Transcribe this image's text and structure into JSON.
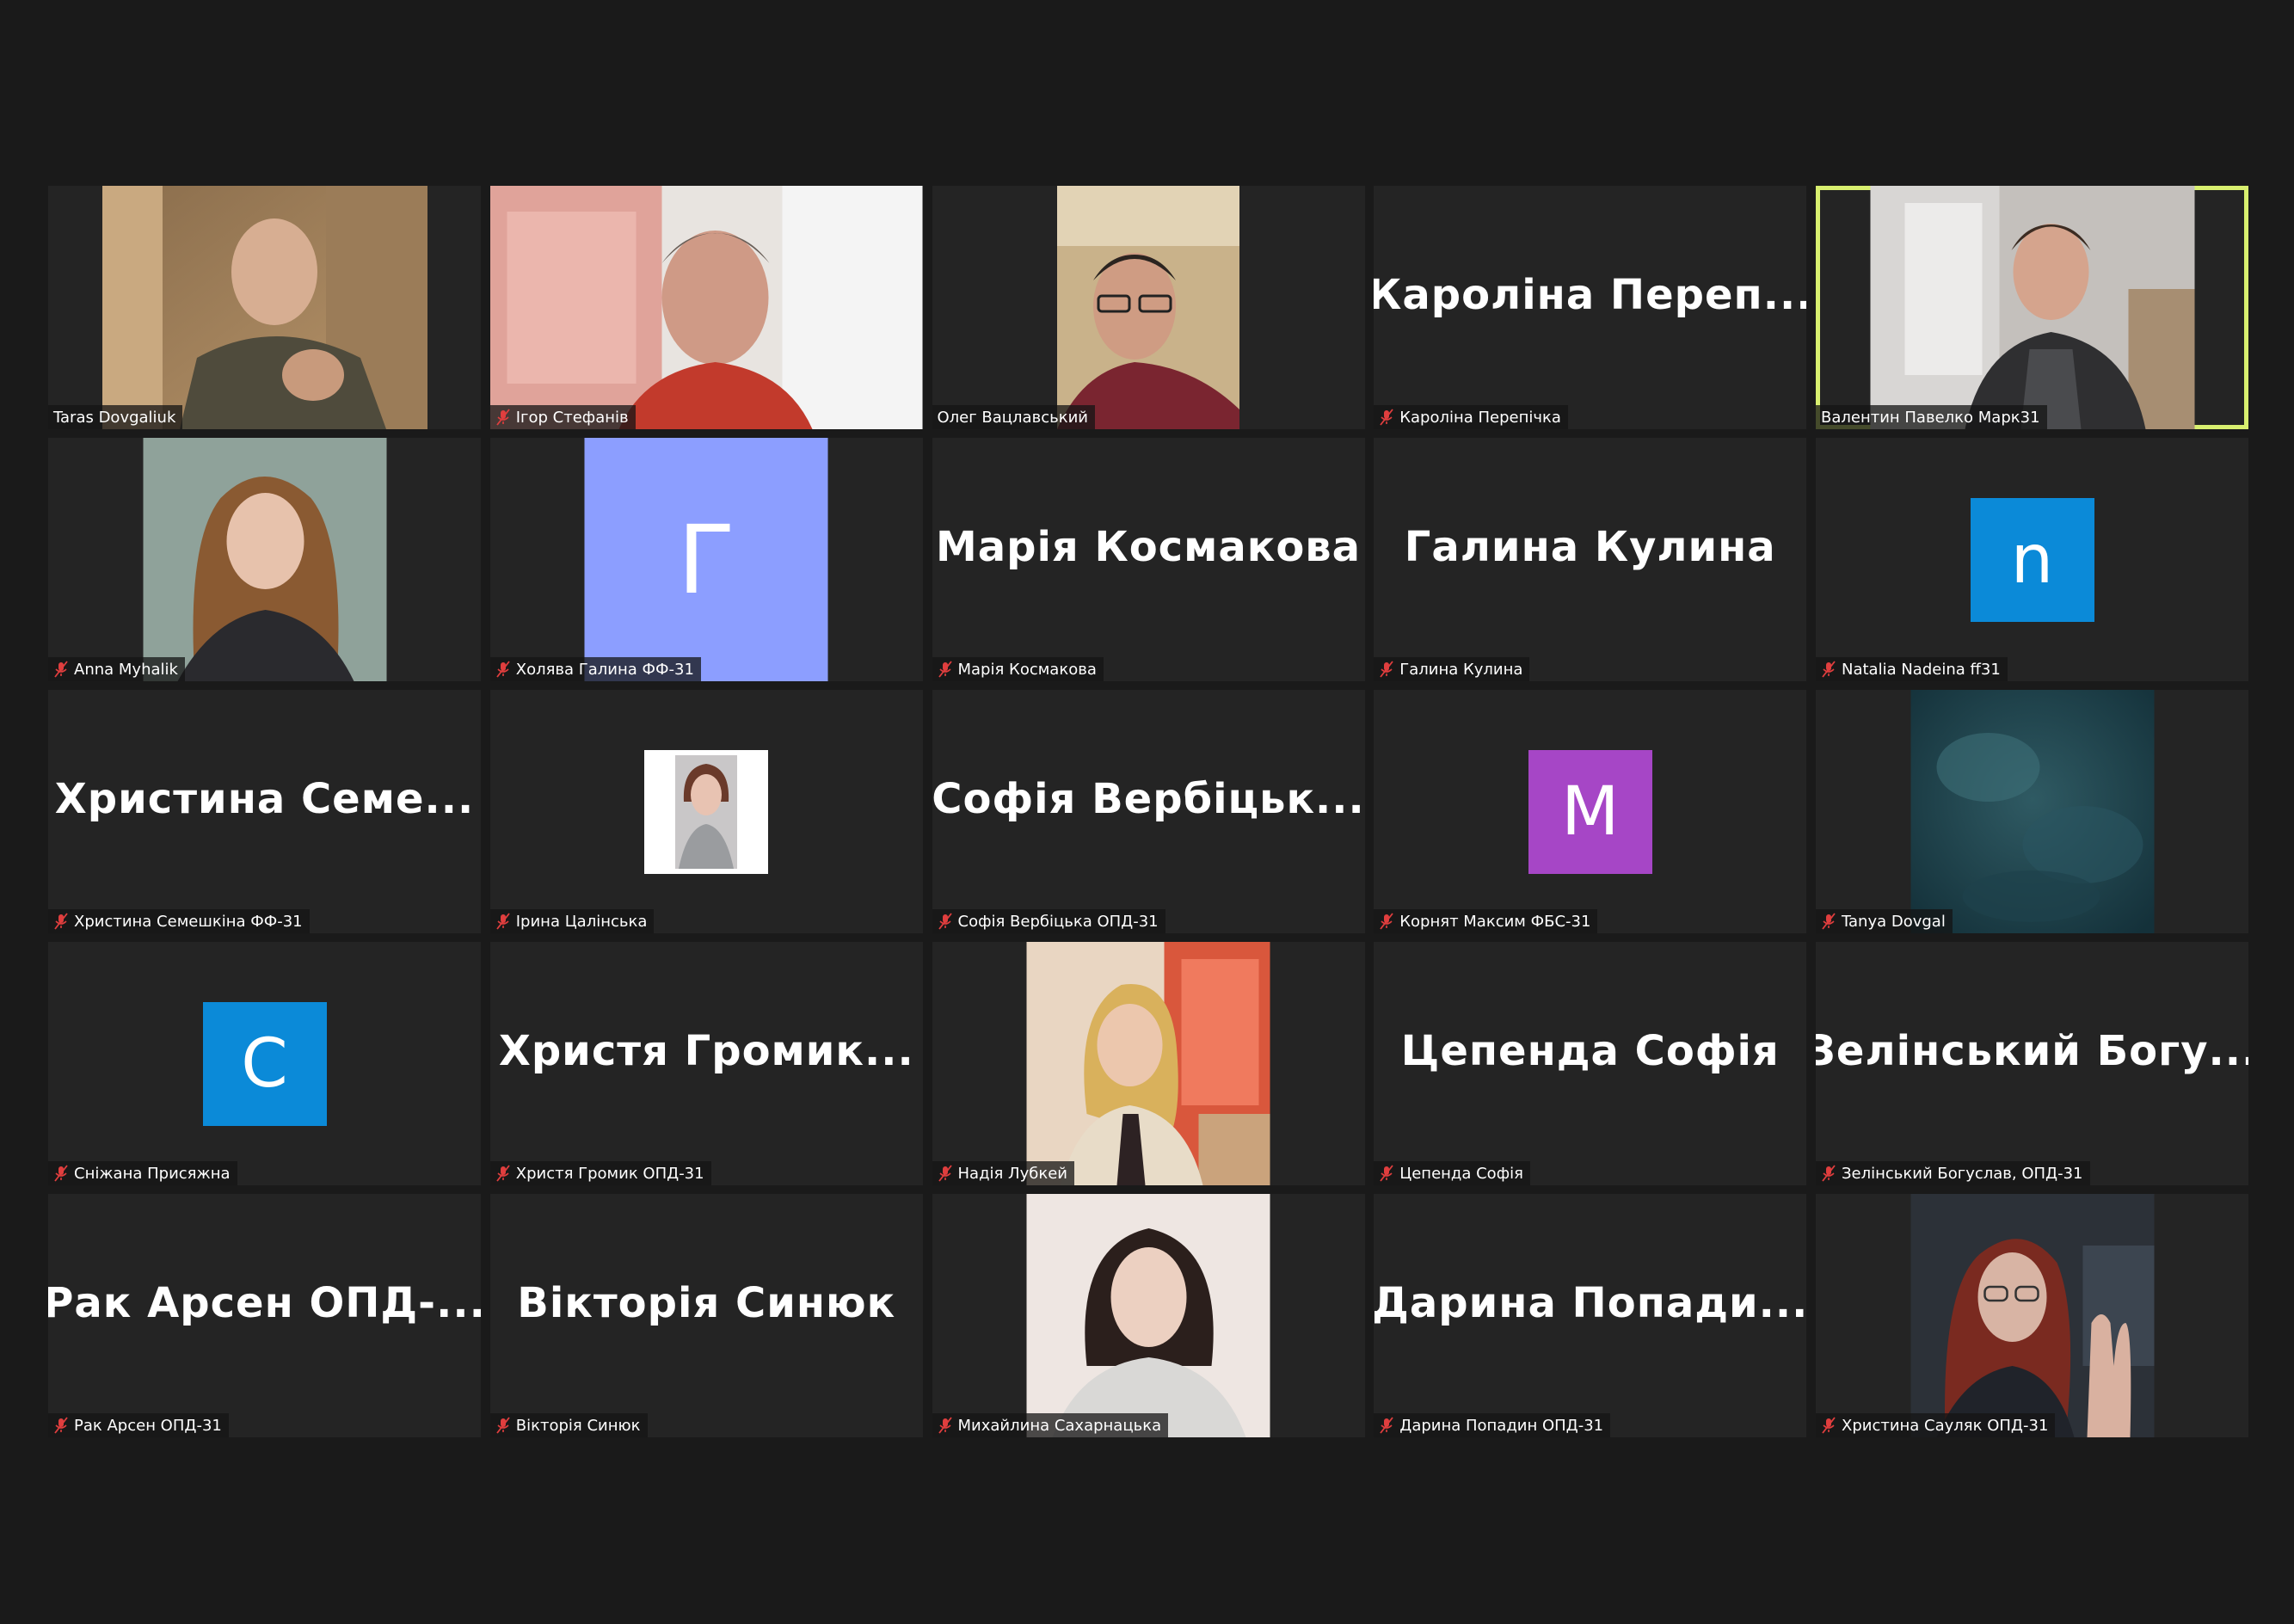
{
  "accent_colors": {
    "active_speaker_border": "#d8ef6f",
    "tile_bg": "#242424",
    "muted_icon": "#e03e3e"
  },
  "participants": [
    {
      "label": "Taras Dovgaliuk",
      "muted": false,
      "display": "video"
    },
    {
      "label": "Ігор Стефанів",
      "muted": true,
      "display": "video"
    },
    {
      "label": "Олег Вацлавський",
      "muted": false,
      "display": "video"
    },
    {
      "label": "Кароліна Перепічка",
      "muted": true,
      "display": "name",
      "big_name": "Кароліна  Переп..."
    },
    {
      "label": "Валентин Павелко Марк31",
      "muted": false,
      "display": "video",
      "active": true
    },
    {
      "label": "Anna Myhalik",
      "muted": true,
      "display": "photo"
    },
    {
      "label": "Холява Галина ФФ-31",
      "muted": true,
      "display": "letter",
      "initial": "Г",
      "avatar_color": "#8c9eff"
    },
    {
      "label": "Марія Космакова",
      "muted": true,
      "display": "name",
      "big_name": "Марія Космакова"
    },
    {
      "label": "Галина Кулина",
      "muted": true,
      "display": "name",
      "big_name": "Галина Кулина"
    },
    {
      "label": "Natalia Nadeina ff31",
      "muted": true,
      "display": "letter",
      "initial": "n",
      "avatar_color": "#0b8ad8"
    },
    {
      "label": "Христина Семешкіна ФФ-31",
      "muted": true,
      "display": "name",
      "big_name": "Христина  Семе..."
    },
    {
      "label": "Ірина Цалінська",
      "muted": true,
      "display": "photo-small"
    },
    {
      "label": "Софія Вербіцька ОПД-31",
      "muted": true,
      "display": "name",
      "big_name": "Софія  Вербіцьк..."
    },
    {
      "label": "Корнят Максим ФБС-31",
      "muted": true,
      "display": "letter",
      "initial": "M",
      "avatar_color": "#a646c6"
    },
    {
      "label": "Tanya Dovgal",
      "muted": true,
      "display": "photo"
    },
    {
      "label": "Сніжана Присяжна",
      "muted": true,
      "display": "letter",
      "initial": "C",
      "avatar_color": "#0b8ad8"
    },
    {
      "label": "Христя Громик ОПД-31",
      "muted": true,
      "display": "name",
      "big_name": "Христя  Громик..."
    },
    {
      "label": "Надія Лубкей",
      "muted": true,
      "display": "photo"
    },
    {
      "label": "Цепенда Софія",
      "muted": true,
      "display": "name",
      "big_name": "Цепенда Софія"
    },
    {
      "label": "Зелінський Богуслав, ОПД-31",
      "muted": true,
      "display": "name",
      "big_name": "Зелінський  Богу..."
    },
    {
      "label": "Рак Арсен ОПД-31",
      "muted": true,
      "display": "name",
      "big_name": "Рак  Арсен  ОПД-..."
    },
    {
      "label": "Вікторія Синюк",
      "muted": true,
      "display": "name",
      "big_name": "Вікторія Синюк"
    },
    {
      "label": "Михайлина Сахарнацька",
      "muted": true,
      "display": "photo"
    },
    {
      "label": "Дарина Попадин ОПД-31",
      "muted": true,
      "display": "name",
      "big_name": "Дарина  Попади..."
    },
    {
      "label": "Христина Сауляк ОПД-31",
      "muted": true,
      "display": "photo"
    }
  ]
}
